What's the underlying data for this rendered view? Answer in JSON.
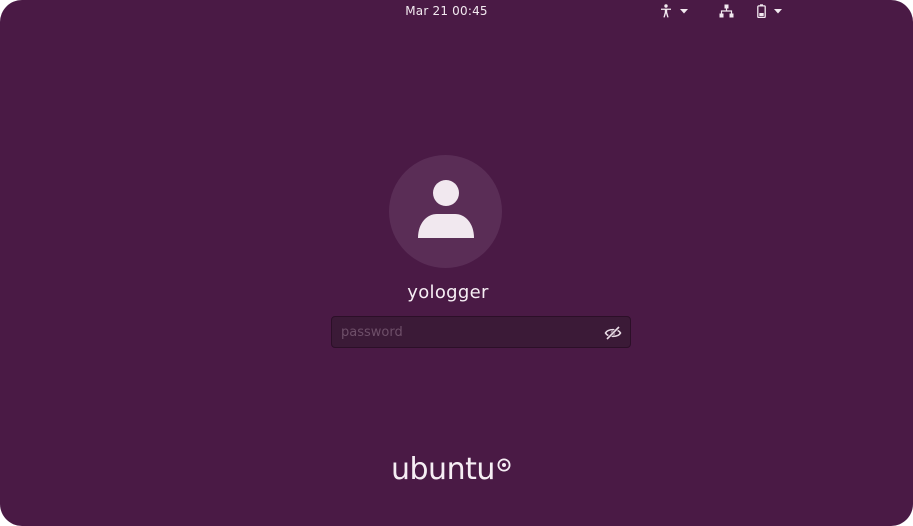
{
  "topbar": {
    "clock": "Mar 21  00:45",
    "icons": {
      "accessibility": "accessibility-icon",
      "network": "network-icon",
      "battery": "battery-icon",
      "caret": "chevron-down-icon"
    }
  },
  "login": {
    "username": "yologger",
    "password": {
      "value": "",
      "placeholder": "password"
    },
    "avatar_icon": "user-icon",
    "reveal_icon": "eye-slash-icon"
  },
  "branding": {
    "logo_text": "ubuntu"
  },
  "colors": {
    "background": "#4a1a45",
    "avatar_bg": "#5a2d56",
    "input_bg": "#3b1a37",
    "text": "#f6eef4"
  }
}
